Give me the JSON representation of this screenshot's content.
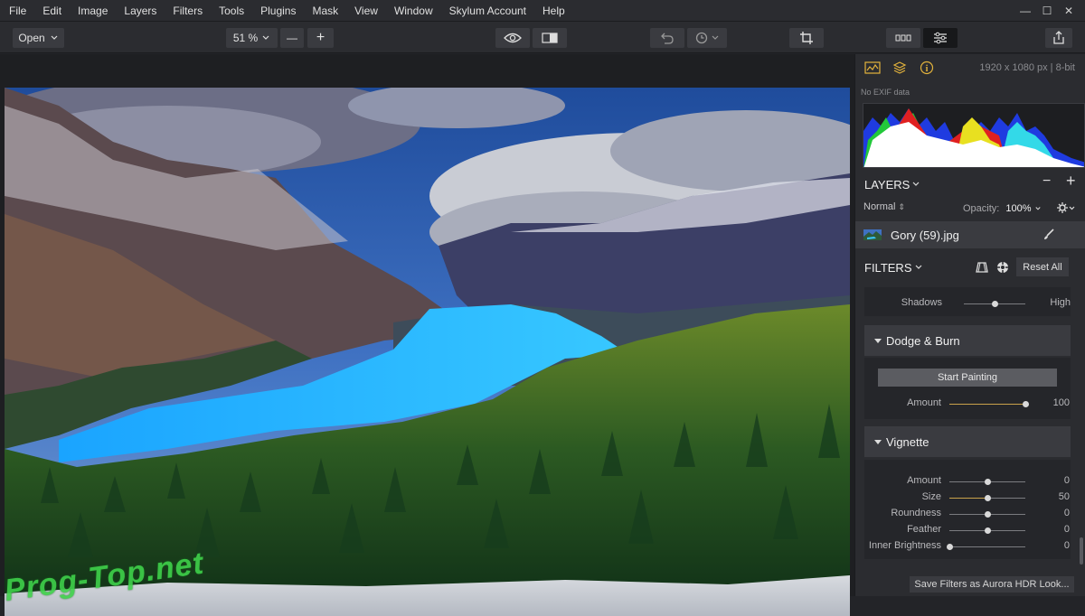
{
  "menu": [
    "File",
    "Edit",
    "Image",
    "Layers",
    "Filters",
    "Tools",
    "Plugins",
    "Mask",
    "View",
    "Window",
    "Skylum Account",
    "Help"
  ],
  "window_controls": {
    "minimize": "—",
    "maximize": "☐",
    "close": "✕"
  },
  "toolbar": {
    "open_label": "Open",
    "zoom_label": "51 %",
    "zoom_out_label": "—",
    "zoom_in_label": "+"
  },
  "panel": {
    "image_info": "1920 x 1080 px  |  8-bit",
    "exif": "No EXIF data",
    "layers": {
      "title": "LAYERS",
      "blend_mode": "Normal",
      "opacity_label": "Opacity:",
      "opacity_value": "100%",
      "layer_name": "Gory (59).jpg"
    },
    "filters": {
      "title": "FILTERS",
      "reset_label": "Reset All",
      "shadows_row": {
        "label": "Shadows",
        "value": "High",
        "level": 0.5
      },
      "dodge_burn": {
        "title": "Dodge & Burn",
        "start_label": "Start Painting",
        "amount": {
          "label": "Amount",
          "value": "100",
          "level": 1.0
        }
      },
      "vignette": {
        "title": "Vignette",
        "sliders": [
          {
            "label": "Amount",
            "value": "0",
            "level": 0.5,
            "fill": false
          },
          {
            "label": "Size",
            "value": "50",
            "level": 0.5,
            "fill": true
          },
          {
            "label": "Roundness",
            "value": "0",
            "level": 0.5,
            "fill": false
          },
          {
            "label": "Feather",
            "value": "0",
            "level": 0.5,
            "fill": false
          },
          {
            "label": "Inner Brightness",
            "value": "0",
            "level": 0.0,
            "fill": false
          }
        ]
      },
      "save_label": "Save Filters as Aurora HDR Look..."
    }
  },
  "watermark": "Prog-Top.net",
  "colors": {
    "accent": "#c9a24b",
    "panel": "#2b2c30",
    "watermark": "#3fd14a"
  },
  "icons": [
    "histogram-icon",
    "layers-icon",
    "info-icon",
    "eye-icon",
    "compare-icon",
    "undo-icon",
    "history-icon",
    "crop-icon",
    "tools-icon",
    "adjustments-icon",
    "export-icon",
    "mask-icon",
    "filter-catalog-icon",
    "gear-icon",
    "brush-icon"
  ]
}
